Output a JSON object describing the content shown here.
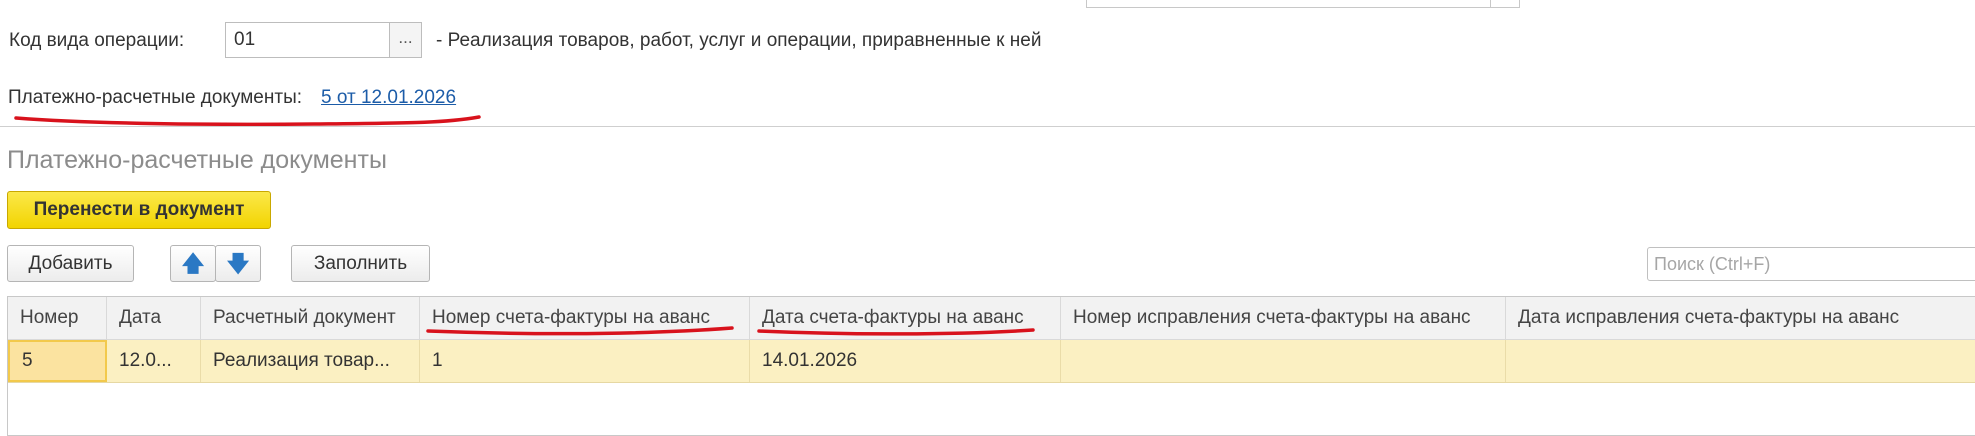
{
  "form": {
    "operation_code_label": "Код вида операции:",
    "operation_code_value": "01",
    "operation_code_picker": "...",
    "operation_code_description": "- Реализация товаров, работ, услуг и операции, приравненные к ней",
    "payment_docs_label": "Платежно-расчетные документы:",
    "payment_docs_link": "5 от 12.01.2026"
  },
  "section": {
    "title": "Платежно-расчетные документы",
    "transfer_button": "Перенести в документ",
    "add_button": "Добавить",
    "move_up_glyph": "🡅",
    "move_down_glyph": "🡇",
    "fill_button": "Заполнить",
    "search_placeholder": "Поиск (Ctrl+F)"
  },
  "table": {
    "columns": [
      "Номер",
      "Дата",
      "Расчетный документ",
      "Номер счета-фактуры на аванс",
      "Дата счета-фактуры на аванс",
      "Номер исправления счета-фактуры на аванс",
      "Дата исправления счета-фактуры на аванс"
    ],
    "rows": [
      [
        "5",
        "12.0...",
        "Реализация товар...",
        "1",
        "14.01.2026",
        "",
        ""
      ]
    ]
  },
  "colors": {
    "accent_button": "#f2d400",
    "link": "#1c5ca8",
    "selected_row": "#fbf0c2",
    "annotation_red": "#d8121c"
  },
  "icons": [
    "arrow-up-icon",
    "arrow-down-icon",
    "ellipsis-icon"
  ]
}
